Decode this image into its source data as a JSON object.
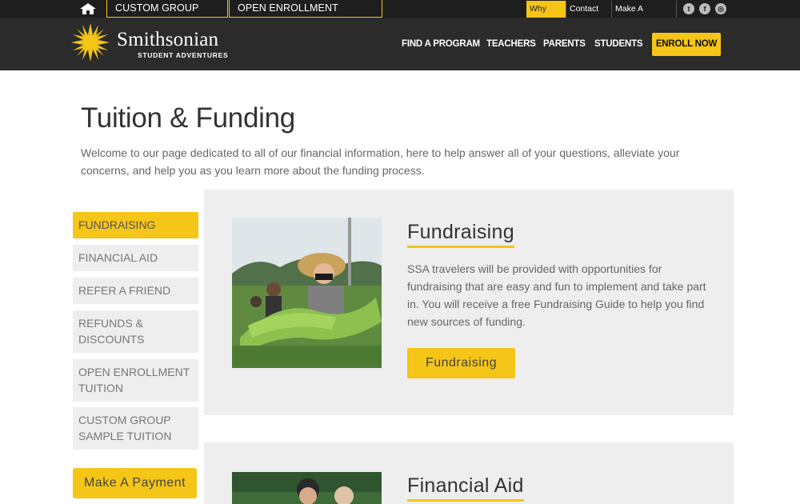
{
  "topbar": {
    "custom_group_travel": "CUSTOM GROUP TRAVEL",
    "open_enrollment_programs": "OPEN ENROLLMENT PROGRAMS",
    "why_ssa": "Why SSA",
    "contact_us": "Contact Us",
    "make_a_payment": "Make A Payment"
  },
  "header": {
    "logo_name": "Smithsonian",
    "logo_sub": "STUDENT ADVENTURES",
    "nav": [
      "FIND A PROGRAM",
      "TEACHERS",
      "PARENTS",
      "STUDENTS"
    ],
    "enroll_now": "ENROLL NOW"
  },
  "page": {
    "title": "Tuition & Funding",
    "intro": "Welcome to our page dedicated to all of our financial information, here to help answer all of your questions, alleviate your concerns, and help you as you learn more about the funding process."
  },
  "sidebar": {
    "items": [
      {
        "label": "FUNDRAISING"
      },
      {
        "label": "FINANCIAL AID"
      },
      {
        "label": "REFER A FRIEND"
      },
      {
        "label": "REFUNDS & DISCOUNTS"
      },
      {
        "label": "OPEN ENROLLMENT TUITION"
      },
      {
        "label": "CUSTOM GROUP SAMPLE TUITION"
      }
    ],
    "make_a_payment": "Make A Payment"
  },
  "cards": [
    {
      "title": "Fundraising",
      "text": "SSA travelers will be provided with opportunities for fundraising that are easy and fun to implement and take part in. You will receive a free Fundraising Guide to help you find new sources of funding.",
      "button": "Fundraising"
    },
    {
      "title": "Financial Aid"
    }
  ],
  "colors": {
    "accent": "#f5c518",
    "header_bg": "#2b2b2b",
    "topbar_bg": "#1e1e1e",
    "panel_bg": "#eeeeee"
  },
  "icons": {
    "home": "home-icon",
    "twitter": "twitter-icon",
    "facebook": "facebook-icon",
    "instagram": "instagram-icon",
    "logo": "sun-logo-icon"
  }
}
